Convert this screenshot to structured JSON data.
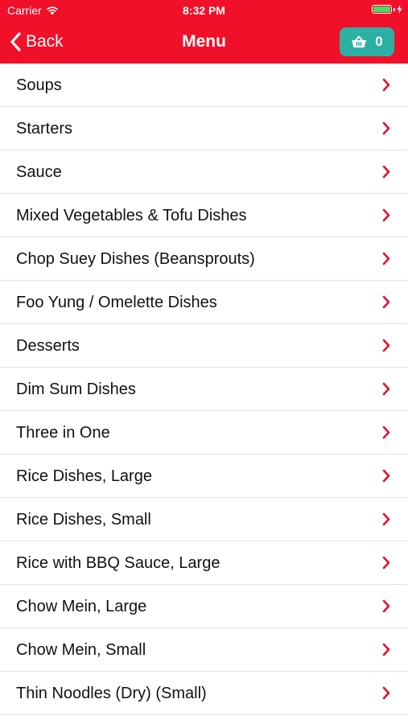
{
  "status_bar": {
    "carrier": "Carrier",
    "time": "8:32 PM",
    "battery_level": 1.0,
    "wifi_icon": "wifi-icon",
    "charging_icon": "bolt-icon"
  },
  "nav": {
    "back_label": "Back",
    "title": "Menu",
    "basket_count": "0",
    "basket_icon": "basket-icon"
  },
  "colors": {
    "header_bg": "#f0102a",
    "basket_bg": "#2db0a4",
    "chevron": "#e8102a",
    "separator": "#e3e3e6"
  },
  "menu": {
    "items": [
      {
        "label": "Soups"
      },
      {
        "label": "Starters"
      },
      {
        "label": "Sauce"
      },
      {
        "label": "Mixed Vegetables & Tofu Dishes"
      },
      {
        "label": "Chop Suey Dishes (Beansprouts)"
      },
      {
        "label": "Foo Yung / Omelette Dishes"
      },
      {
        "label": "Desserts"
      },
      {
        "label": "Dim Sum Dishes"
      },
      {
        "label": "Three in One"
      },
      {
        "label": "Rice Dishes, Large"
      },
      {
        "label": "Rice Dishes, Small"
      },
      {
        "label": "Rice with BBQ Sauce, Large"
      },
      {
        "label": "Chow Mein, Large"
      },
      {
        "label": "Chow Mein, Small"
      },
      {
        "label": "Thin Noodles (Dry) (Small)"
      }
    ]
  }
}
